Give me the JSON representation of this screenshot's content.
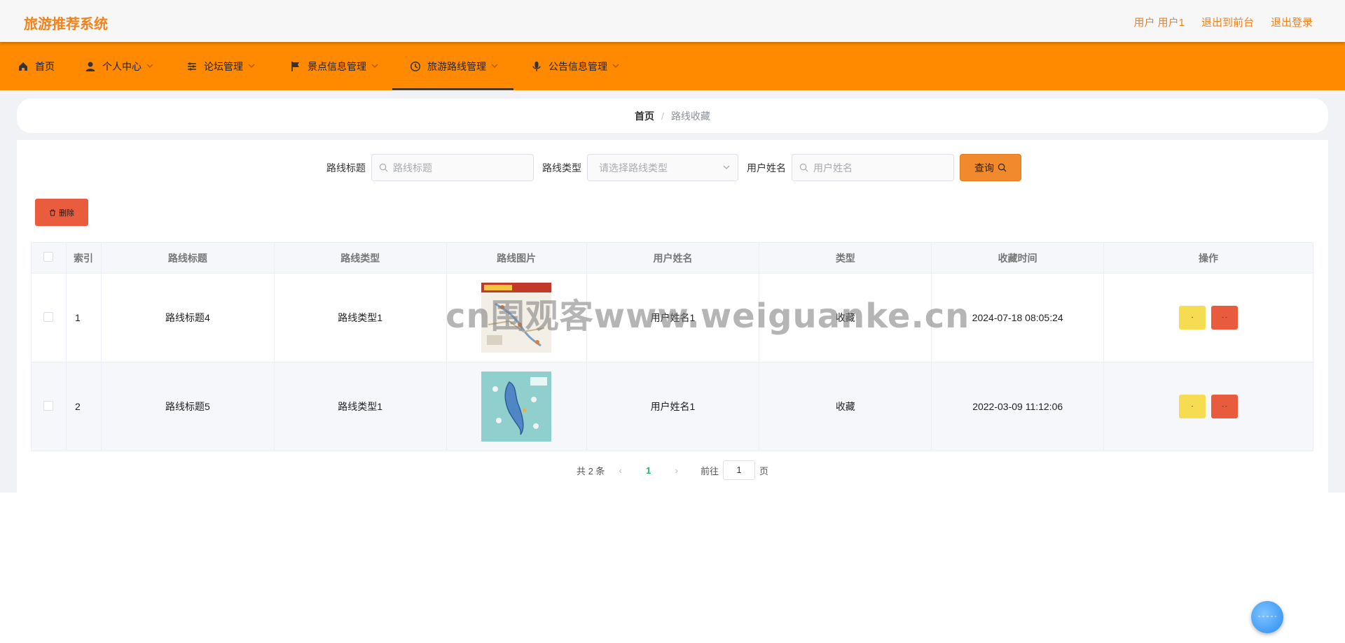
{
  "header": {
    "logo": "旅游推荐系统",
    "user": "用户 用户1",
    "to_front": "退出到前台",
    "logout": "退出登录"
  },
  "nav": {
    "items": [
      {
        "label": "首页",
        "icon": "home-icon"
      },
      {
        "label": "个人中心",
        "icon": "user-icon"
      },
      {
        "label": "论坛管理",
        "icon": "sliders-icon"
      },
      {
        "label": "景点信息管理",
        "icon": "flag-icon"
      },
      {
        "label": "旅游路线管理",
        "icon": "clock-icon"
      },
      {
        "label": "公告信息管理",
        "icon": "mic-icon"
      }
    ],
    "active_index": 4
  },
  "breadcrumb": {
    "home": "首页",
    "sep": "/",
    "current": "路线收藏"
  },
  "search": {
    "title_label": "路线标题",
    "title_placeholder": "路线标题",
    "type_label": "路线类型",
    "type_placeholder": "请选择路线类型",
    "user_label": "用户姓名",
    "user_placeholder": "用户姓名",
    "query_label": "查询"
  },
  "actions": {
    "delete_label": "删除"
  },
  "table": {
    "headers": [
      "索引",
      "路线标题",
      "路线类型",
      "路线图片",
      "用户姓名",
      "类型",
      "收藏时间",
      "操作"
    ],
    "rows": [
      {
        "index": "1",
        "title": "路线标题4",
        "type": "路线类型1",
        "user": "用户姓名1",
        "kind": "收藏",
        "time": "2024-07-18 08:05:24"
      },
      {
        "index": "2",
        "title": "路线标题5",
        "type": "路线类型1",
        "user": "用户姓名1",
        "kind": "收藏",
        "time": "2022-03-09 11:12:06"
      }
    ]
  },
  "pagination": {
    "total": "共 2 条",
    "current_page": "1",
    "goto_label": "前往",
    "goto_value": "1",
    "page_suffix": "页"
  },
  "watermark": "cn围观客www.weiguanke.cn",
  "colors": {
    "accent": "#ff8a00",
    "brand_text": "#f0831c",
    "danger": "#ea5c3e",
    "warning": "#f5dc50",
    "page_active": "#21b573"
  }
}
